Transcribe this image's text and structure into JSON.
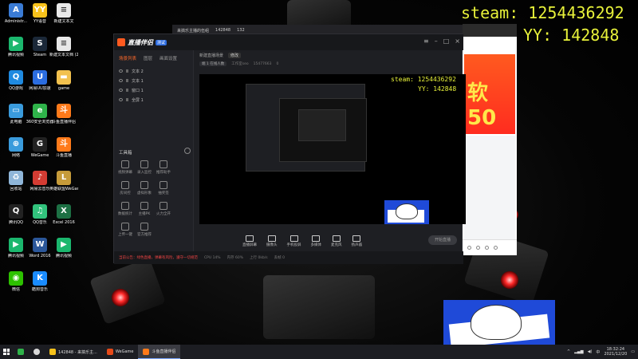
{
  "overlay": {
    "steam": "steam: 1254436292",
    "yy": "YY: 142848",
    "steam_inner": "steam: 1254436292",
    "yy_inner": "YY: 142848"
  },
  "desktop_icons": [
    {
      "label": "Administr...",
      "icon": "user-folder-icon",
      "color": "#3a7bd5",
      "glyph": "A"
    },
    {
      "label": "YY语音",
      "icon": "yy-icon",
      "color": "#f7c21b",
      "glyph": "YY"
    },
    {
      "label": "新建文本文",
      "icon": "text-file-icon",
      "color": "#e8e8e8",
      "glyph": "≡"
    },
    {
      "label": "腾讯视频",
      "icon": "tencent-video-icon",
      "color": "#1bb76e",
      "glyph": "▶"
    },
    {
      "label": "Steam",
      "icon": "steam-icon",
      "color": "#1b2838",
      "glyph": "S"
    },
    {
      "label": "新建文本文档 (2)",
      "icon": "text-file-icon",
      "color": "#e8e8e8",
      "glyph": "≡"
    },
    {
      "label": "QQ游戏",
      "icon": "qq-game-icon",
      "color": "#1f8ae0",
      "glyph": "Q"
    },
    {
      "label": "网易UU加速",
      "icon": "uu-icon",
      "color": "#2b6de0",
      "glyph": "U"
    },
    {
      "label": "game",
      "icon": "folder-icon",
      "color": "#f2c14e",
      "glyph": "▬"
    },
    {
      "label": "此电脑",
      "icon": "computer-icon",
      "color": "#3a9bdc",
      "glyph": "▭"
    },
    {
      "label": "360安全浏览器",
      "icon": "360-browser-icon",
      "color": "#2fb34a",
      "glyph": "e"
    },
    {
      "label": "斗鱼直播伴侣",
      "icon": "douyu-icon",
      "color": "#ff7a1a",
      "glyph": "斗"
    },
    {
      "label": "网络",
      "icon": "network-icon",
      "color": "#3a9bdc",
      "glyph": "⊕"
    },
    {
      "label": "WeGame",
      "icon": "wegame-icon",
      "color": "#222",
      "glyph": "G"
    },
    {
      "label": "斗鱼直播",
      "icon": "douyu-live-icon",
      "color": "#ff7a1a",
      "glyph": "斗"
    },
    {
      "label": "回收站",
      "icon": "recycle-bin-icon",
      "color": "#8fb6d9",
      "glyph": "♻"
    },
    {
      "label": "网易云音乐",
      "icon": "netease-music-icon",
      "color": "#d43c33",
      "glyph": "♪"
    },
    {
      "label": "英雄联盟WeGame版",
      "icon": "lol-icon",
      "color": "#c69b3a",
      "glyph": "L"
    },
    {
      "label": "腾讯QQ",
      "icon": "qq-icon",
      "color": "#222",
      "glyph": "Q"
    },
    {
      "label": "QQ音乐",
      "icon": "qq-music-icon",
      "color": "#31c27c",
      "glyph": "♫"
    },
    {
      "label": "Excel 2016",
      "icon": "excel-icon",
      "color": "#1d7044",
      "glyph": "X"
    },
    {
      "label": "腾讯视频",
      "icon": "tencent-video-icon",
      "color": "#1bb76e",
      "glyph": "▶"
    },
    {
      "label": "Word 2016",
      "icon": "word-icon",
      "color": "#2b579a",
      "glyph": "W"
    },
    {
      "label": "腾讯视频",
      "icon": "tencent-video-icon",
      "color": "#1bb76e",
      "glyph": "▶"
    },
    {
      "label": "微信",
      "icon": "wechat-icon",
      "color": "#2dc100",
      "glyph": "◉"
    },
    {
      "label": "酷狗音乐",
      "icon": "kugou-icon",
      "color": "#1a8cff",
      "glyph": "K"
    }
  ],
  "app": {
    "name": "直播伴侣",
    "version": "测试",
    "room_title": "新建直播场景",
    "room_badge": "修改",
    "room_sub_tag": "端 1 在线人数",
    "room_id": "工作室seo",
    "room_count": "15477663",
    "room_fans": "0",
    "side_tabs": [
      "场景列表",
      "图层",
      "画面设置"
    ],
    "scenes": [
      "文本 2",
      "文本 1",
      "窗口 1",
      "全屏 1"
    ],
    "tools_title": "工具箱",
    "tools": [
      {
        "label": "视频弹幕",
        "icon": "danmu-icon"
      },
      {
        "label": "录入监控",
        "icon": "monitor-icon"
      },
      {
        "label": "推荐助手",
        "icon": "assist-icon"
      },
      {
        "label": "",
        "icon": "blank"
      },
      {
        "label": "房间控",
        "icon": "room-control-icon"
      },
      {
        "label": "虚拟形象",
        "icon": "avatar-icon"
      },
      {
        "label": "抽奖签",
        "icon": "lottery-icon"
      },
      {
        "label": "",
        "icon": "blank"
      },
      {
        "label": "数据统计",
        "icon": "stats-icon"
      },
      {
        "label": "主播PK",
        "icon": "pk-icon"
      },
      {
        "label": "火力全开",
        "icon": "fire-icon"
      },
      {
        "label": "",
        "icon": "blank"
      },
      {
        "label": "上传一键",
        "icon": "upload-icon"
      },
      {
        "label": "官方推荐",
        "icon": "recommend-icon"
      }
    ],
    "bottom_tools": [
      {
        "label": "直播屏幕",
        "icon": "screen-share-icon"
      },
      {
        "label": "摄像头",
        "icon": "camera-icon"
      },
      {
        "label": "手机投屏",
        "icon": "phone-cast-icon"
      },
      {
        "label": "多媒体",
        "icon": "media-icon"
      },
      {
        "label": "麦克风",
        "icon": "microphone-icon"
      },
      {
        "label": "扬声器",
        "icon": "speaker-icon"
      }
    ],
    "go_live": "开始直播",
    "status_warn": "当前公告：绿色直播，弹幕有风险，遵守一切规范",
    "status_items": [
      "CPU 14%",
      "内存 60%",
      "上行 0kb/s",
      "丢帧 0"
    ]
  },
  "top_strip": {
    "title": "来搞乐主播的伍组",
    "room": "142848",
    "viewers": "132"
  },
  "browser": {
    "banner_text": "软50"
  },
  "taskbar": {
    "items": [
      {
        "label": "142848 - 来搞乐主...",
        "icon": "yy-icon",
        "color": "#f7c21b",
        "active": false
      },
      {
        "label": "WeGame",
        "icon": "wegame-icon",
        "color": "#e64a19",
        "active": false
      },
      {
        "label": "斗鱼直播伴侣",
        "icon": "douyu-icon",
        "color": "#ff7a1a",
        "active": true
      }
    ],
    "time": "18:32:24",
    "date": "2021/12/20",
    "ime": "中"
  },
  "colors": {
    "overlay_text": "#e8f23a",
    "accent": "#ff6a2a"
  }
}
